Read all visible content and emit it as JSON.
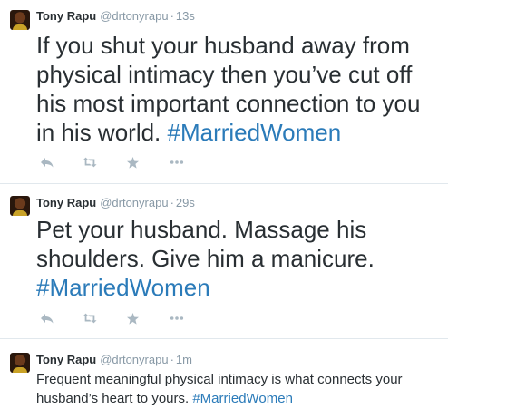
{
  "tweets": [
    {
      "name": "Tony Rapu",
      "handle": "@drtonyrapu",
      "separator": "·",
      "time": "13s",
      "text": "If you shut your husband away from physical intimacy then you’ve cut off his most important connection to you in his world. ",
      "hashtag": "#MarriedWomen"
    },
    {
      "name": "Tony Rapu",
      "handle": "@drtonyrapu",
      "separator": "·",
      "time": "29s",
      "text": "Pet your husband. Massage his shoulders. Give him a manicure. ",
      "hashtag": "#MarriedWomen"
    },
    {
      "name": "Tony Rapu",
      "handle": "@drtonyrapu",
      "separator": "·",
      "time": "1m",
      "text": "Frequent meaningful physical intimacy is what connects your husband’s heart to yours. ",
      "hashtag": "#MarriedWomen"
    }
  ],
  "icons": {
    "reply": "reply-icon",
    "retweet": "retweet-icon",
    "favorite": "star-icon",
    "more": "more-icon"
  },
  "colors": {
    "name": "#292f33",
    "meta": "#8899a6",
    "hashtag": "#2b7bb9",
    "action_icon": "#aab8c2",
    "divider": "#e1e8ed"
  }
}
